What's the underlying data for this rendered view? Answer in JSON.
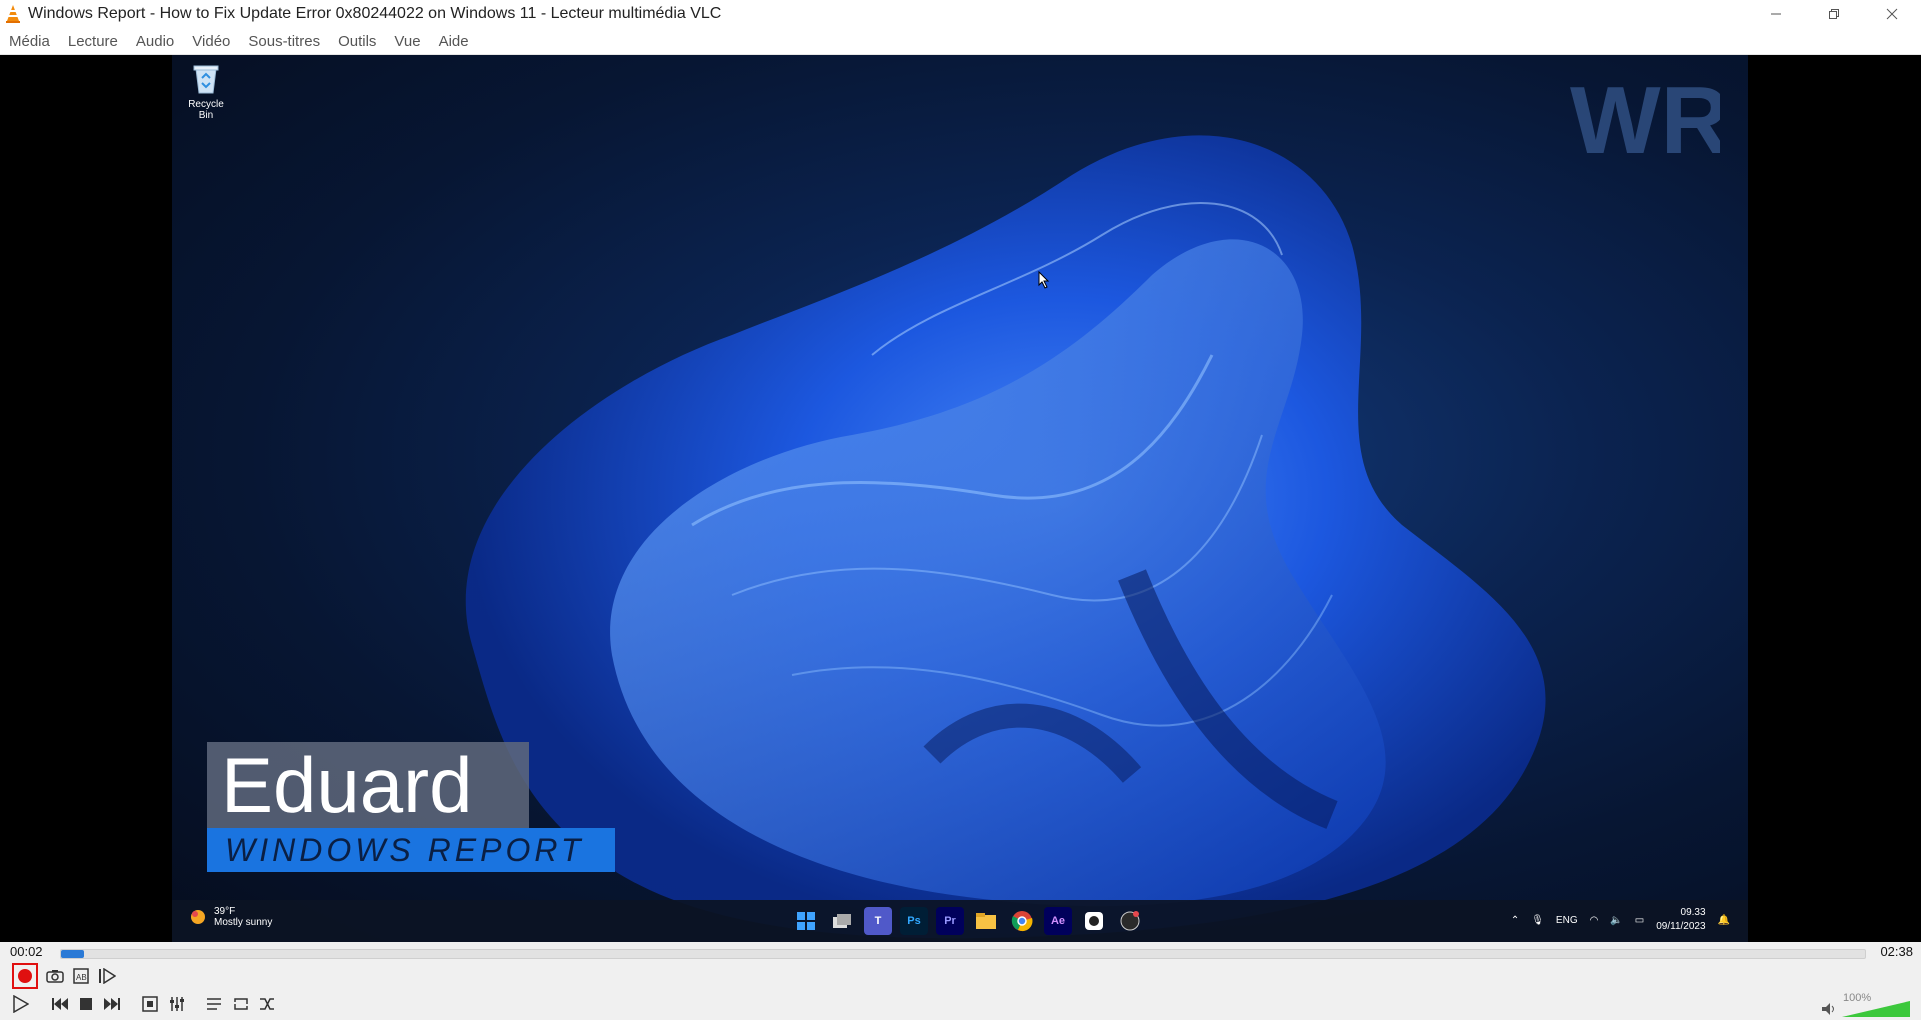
{
  "window": {
    "title": "Windows Report - How to Fix Update Error 0x80244022 on Windows 11 - Lecteur multimédia VLC"
  },
  "menu": [
    "Média",
    "Lecture",
    "Audio",
    "Vidéo",
    "Sous-titres",
    "Outils",
    "Vue",
    "Aide"
  ],
  "video_content": {
    "desktop_icon_label": "Recycle Bin",
    "logo_text": "WR",
    "lower_third": {
      "name": "Eduard",
      "brand": "WINDOWS REPORT"
    },
    "taskbar": {
      "weather_temp": "39°F",
      "weather_desc": "Mostly sunny",
      "apps": [
        "start-icon",
        "task-view-icon",
        "teams-icon",
        "photoshop-icon",
        "premiere-icon",
        "file-explorer-icon",
        "chrome-icon",
        "after-effects-icon",
        "app-icon",
        "obs-icon"
      ],
      "app_labels": {
        "photoshop": "Ps",
        "premiere": "Pr",
        "after_effects": "Ae"
      },
      "language": "ENG",
      "clock_time": "09.33",
      "clock_date": "09/11/2023"
    }
  },
  "playback": {
    "elapsed": "00:02",
    "total": "02:38",
    "progress_fraction": 0.013,
    "volume_label": "100%",
    "volume_fraction": 1.0
  },
  "colors": {
    "accent": "#2b7ad6",
    "record_highlight": "#e01010",
    "volume_fill": "#3cc83c"
  }
}
